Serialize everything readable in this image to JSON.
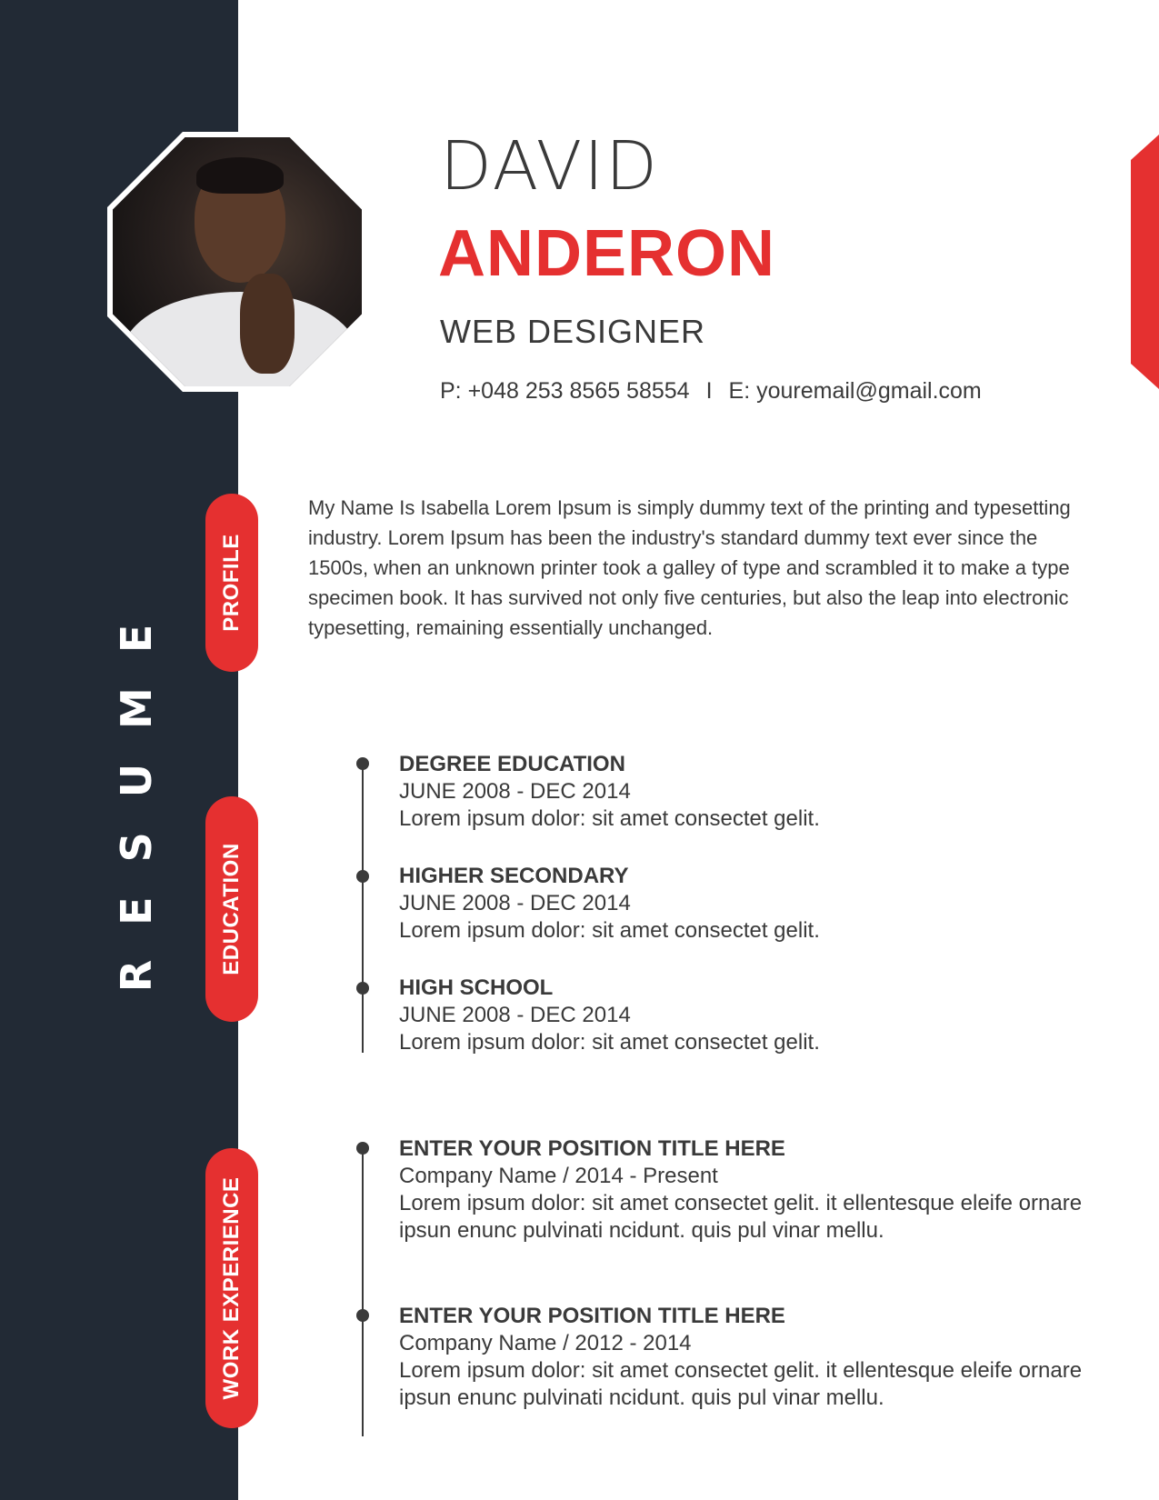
{
  "sidebar": {
    "vertical_title": "RESUME"
  },
  "header": {
    "first_name": "DAVID",
    "last_name": "ANDERON",
    "job_title": "WEB DESIGNER",
    "phone": "P: +048 253 8565 58554",
    "separator": "I",
    "email": "E:  youremail@gmail.com"
  },
  "sections": {
    "profile_label": "PROFILE",
    "education_label": "EDUCATION",
    "work_label": "WORK EXPERIENCE"
  },
  "profile": {
    "text": "My Name Is Isabella Lorem Ipsum is simply dummy text of the printing and typesetting industry. Lorem Ipsum has been the industry's standard dummy text ever since the 1500s, when an unknown printer took a galley of type and scrambled it to make a type specimen book. It has survived not only five centuries, but also the leap into electronic typesetting, remaining essentially unchanged."
  },
  "education": [
    {
      "title": "DEGREE EDUCATION",
      "dates": "JUNE 2008 - DEC 2014",
      "desc": "Lorem ipsum dolor: sit amet consectet gelit."
    },
    {
      "title": "HIGHER SECONDARY",
      "dates": "JUNE 2008 - DEC 2014",
      "desc": "Lorem ipsum dolor: sit amet consectet gelit."
    },
    {
      "title": "HIGH SCHOOL",
      "dates": "JUNE 2008 - DEC 2014",
      "desc": "Lorem ipsum dolor: sit amet consectet gelit."
    }
  ],
  "work": [
    {
      "title": "ENTER YOUR POSITION TITLE HERE",
      "company": "Company Name / 2014 - Present",
      "desc": "Lorem ipsum dolor: sit amet consectet gelit. it ellentesque eleife ornare ipsun enunc pulvinati ncidunt. quis pul vinar mellu."
    },
    {
      "title": "ENTER YOUR POSITION TITLE HERE",
      "company": "Company Name / 2012 - 2014",
      "desc": "Lorem ipsum dolor: sit amet consectet gelit. it ellentesque eleife ornare ipsun enunc pulvinati ncidunt. quis pul vinar mellu."
    }
  ],
  "colors": {
    "sidebar": "#222a35",
    "accent": "#e53030",
    "text": "#3a3a3a"
  }
}
